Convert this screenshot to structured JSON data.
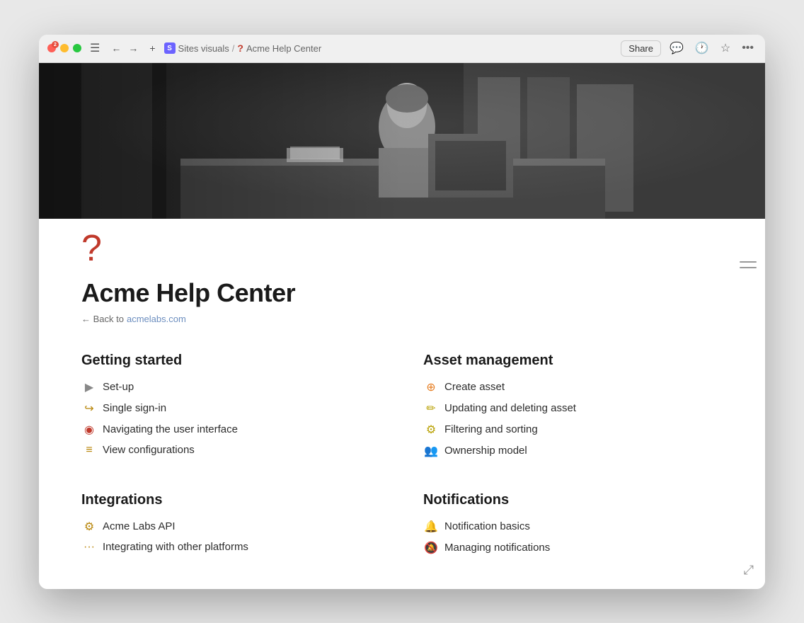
{
  "titlebar": {
    "traffic_lights": {
      "badge": "2"
    },
    "breadcrumb": {
      "site_label": "S",
      "sites_visuals": "Sites visuals",
      "separator": "/",
      "question_mark": "?",
      "current_page": "Acme Help Center"
    },
    "actions": {
      "share_label": "Share"
    }
  },
  "page": {
    "icon": "?",
    "title": "Acme Help Center",
    "back_text": "← Back to",
    "back_link": "acmelabs.com"
  },
  "sections": [
    {
      "id": "getting-started",
      "title": "Getting started",
      "items": [
        {
          "id": "set-up",
          "icon": "▶",
          "icon_color": "#555",
          "label": "Set-up"
        },
        {
          "id": "single-sign-in",
          "icon": "🔑",
          "icon_color": "#8b6914",
          "label": "Single sign-in"
        },
        {
          "id": "navigating-ui",
          "icon": "🧭",
          "icon_color": "#c0392b",
          "label": "Navigating the user interface"
        },
        {
          "id": "view-configs",
          "icon": "☰",
          "icon_color": "#8b6914",
          "label": "View configurations"
        }
      ]
    },
    {
      "id": "asset-management",
      "title": "Asset management",
      "items": [
        {
          "id": "create-asset",
          "icon": "⊕",
          "icon_color": "#e67e22",
          "label": "Create asset"
        },
        {
          "id": "update-delete",
          "icon": "✏",
          "icon_color": "#c0a000",
          "label": "Updating and deleting asset"
        },
        {
          "id": "filter-sort",
          "icon": "⚙",
          "icon_color": "#c0a000",
          "label": "Filtering and sorting"
        },
        {
          "id": "ownership",
          "icon": "👥",
          "icon_color": "#c0a000",
          "label": "Ownership model"
        }
      ]
    },
    {
      "id": "integrations",
      "title": "Integrations",
      "items": [
        {
          "id": "acme-api",
          "icon": "⚙",
          "icon_color": "#8b6914",
          "label": "Acme Labs API"
        },
        {
          "id": "other-platforms",
          "icon": "•••",
          "icon_color": "#8b6914",
          "label": "Integrating with other platforms"
        }
      ]
    },
    {
      "id": "notifications",
      "title": "Notifications",
      "items": [
        {
          "id": "notif-basics",
          "icon": "🔔",
          "icon_color": "#c0392b",
          "label": "Notification basics"
        },
        {
          "id": "managing-notifs",
          "icon": "🔕",
          "icon_color": "#555",
          "label": "Managing notifications"
        }
      ]
    }
  ]
}
